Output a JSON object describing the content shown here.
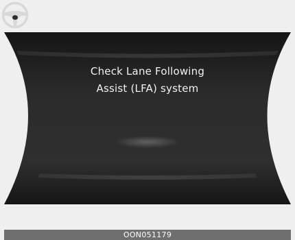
{
  "display": {
    "message_line_1": "Check Lane Following",
    "message_line_2": "Assist (LFA) system",
    "icon": "steering-wheel-icon"
  },
  "footer": {
    "code": "OON051179"
  },
  "colors": {
    "background": "#efefef",
    "panel": "#2a2a2a",
    "text": "#f2f2f2",
    "footer_bar": "#6f6f6f"
  }
}
